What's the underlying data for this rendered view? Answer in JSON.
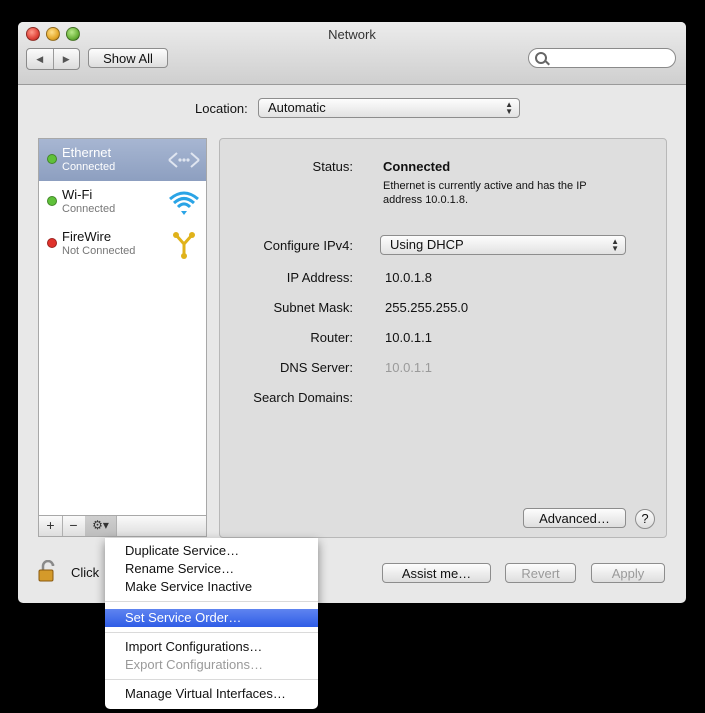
{
  "window": {
    "title": "Network"
  },
  "toolbar": {
    "show_all": "Show All",
    "search_placeholder": ""
  },
  "location": {
    "label": "Location:",
    "value": "Automatic"
  },
  "services": [
    {
      "name": "Ethernet",
      "status": "Connected",
      "dot_color": "#5fc13a",
      "icon": "ethernet-icon",
      "selected": true
    },
    {
      "name": "Wi-Fi",
      "status": "Connected",
      "dot_color": "#5fc13a",
      "icon": "wifi-icon",
      "selected": false
    },
    {
      "name": "FireWire",
      "status": "Not Connected",
      "dot_color": "#e0322b",
      "icon": "firewire-icon",
      "selected": false
    }
  ],
  "detail": {
    "status_label": "Status:",
    "status_value": "Connected",
    "status_desc_line1": "Ethernet is currently active and has the IP",
    "status_desc_line2": "address 10.0.1.8.",
    "configure_label": "Configure IPv4:",
    "configure_value": "Using DHCP",
    "ip_label": "IP Address:",
    "ip_value": "10.0.1.8",
    "subnet_label": "Subnet Mask:",
    "subnet_value": "255.255.255.0",
    "router_label": "Router:",
    "router_value": "10.0.1.1",
    "dns_label": "DNS Server:",
    "dns_value": "10.0.1.1",
    "search_label": "Search Domains:",
    "advanced": "Advanced…",
    "help": "?"
  },
  "sidebar_toolbar": {
    "add": "+",
    "remove": "−",
    "gear": "⚙▾"
  },
  "bottom": {
    "lock_text": "Click",
    "assist": "Assist me…",
    "revert": "Revert",
    "apply": "Apply"
  },
  "menu": {
    "items": [
      {
        "label": "Duplicate Service…",
        "enabled": true
      },
      {
        "label": "Rename Service…",
        "enabled": true
      },
      {
        "label": "Make Service Inactive",
        "enabled": true
      },
      {
        "label": "Set Service Order…",
        "enabled": true,
        "highlighted": true
      },
      {
        "label": "Import Configurations…",
        "enabled": true
      },
      {
        "label": "Export Configurations…",
        "enabled": false
      },
      {
        "label": "Manage Virtual Interfaces…",
        "enabled": true
      }
    ]
  },
  "colors": {
    "selection": "#8d9fc0",
    "menu_highlight": "#2f5de6",
    "disabled_text": "#9a9a9a"
  }
}
